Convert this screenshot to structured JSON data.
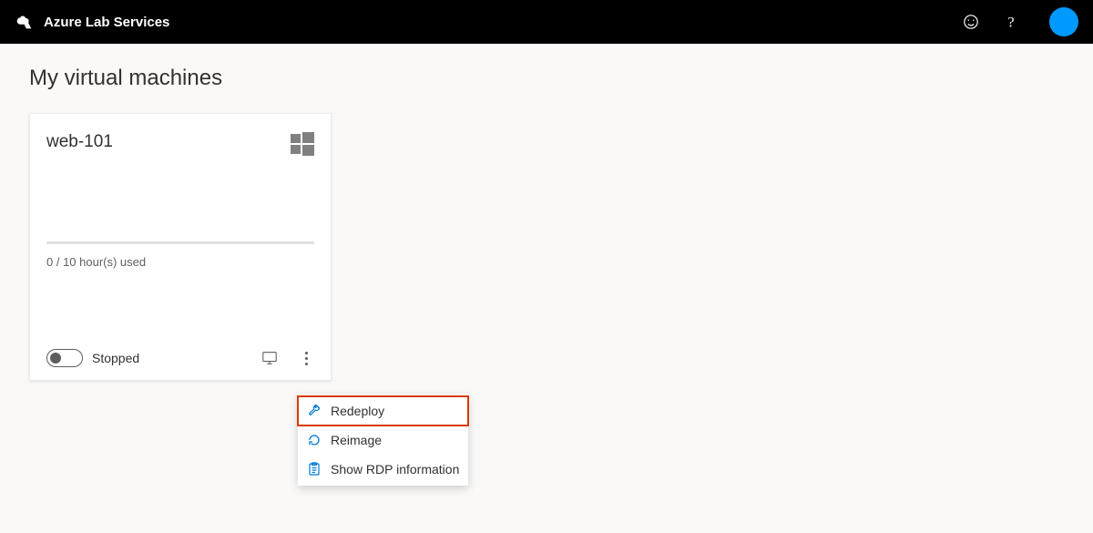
{
  "header": {
    "brand": "Azure Lab Services"
  },
  "page": {
    "title": "My virtual machines"
  },
  "vm": {
    "name": "web-101",
    "os": "windows",
    "usage_text": "0 / 10 hour(s) used",
    "status": "Stopped"
  },
  "menu": {
    "redeploy": "Redeploy",
    "reimage": "Reimage",
    "show_rdp": "Show RDP information"
  }
}
